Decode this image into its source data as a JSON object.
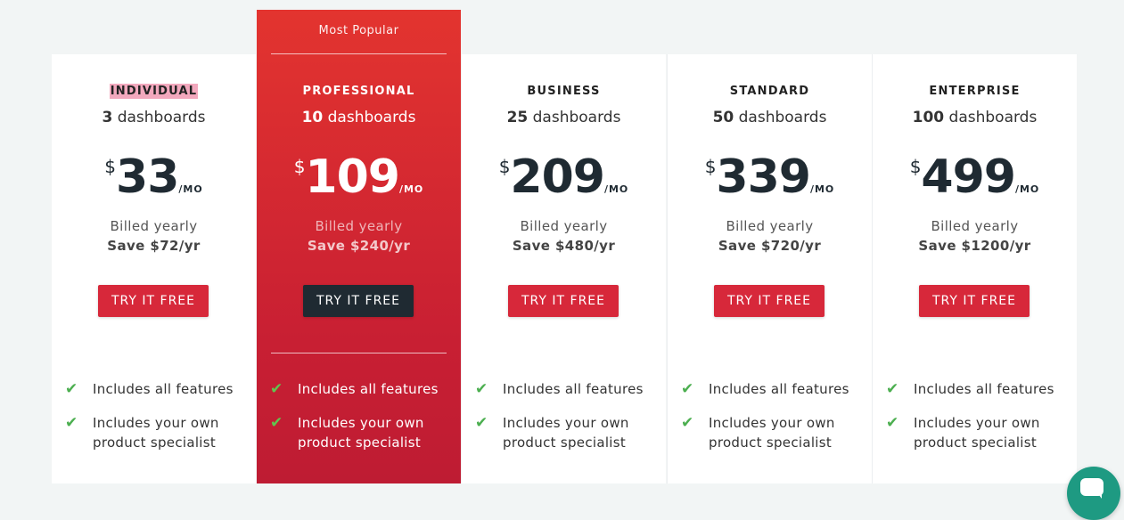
{
  "badge": "Most Popular",
  "plans": [
    {
      "tier": "INDIVIDUAL",
      "count": "3",
      "dash_label": "dashboards",
      "currency": "$",
      "price": "33",
      "period": "/MO",
      "billed": "Billed yearly",
      "save": "Save $72/yr",
      "cta": "TRY IT FREE"
    },
    {
      "tier": "PROFESSIONAL",
      "count": "10",
      "dash_label": "dashboards",
      "currency": "$",
      "price": "109",
      "period": "/MO",
      "billed": "Billed yearly",
      "save": "Save $240/yr",
      "cta": "TRY IT FREE"
    },
    {
      "tier": "BUSINESS",
      "count": "25",
      "dash_label": "dashboards",
      "currency": "$",
      "price": "209",
      "period": "/MO",
      "billed": "Billed yearly",
      "save": "Save $480/yr",
      "cta": "TRY IT FREE"
    },
    {
      "tier": "STANDARD",
      "count": "50",
      "dash_label": "dashboards",
      "currency": "$",
      "price": "339",
      "period": "/MO",
      "billed": "Billed yearly",
      "save": "Save $720/yr",
      "cta": "TRY IT FREE"
    },
    {
      "tier": "ENTERPRISE",
      "count": "100",
      "dash_label": "dashboards",
      "currency": "$",
      "price": "499",
      "period": "/MO",
      "billed": "Billed yearly",
      "save": "Save $1200/yr",
      "cta": "TRY IT FREE"
    }
  ],
  "features": [
    "Includes all features",
    "Includes your own product specialist"
  ],
  "check_icon": "check-icon",
  "chat_icon": "chat-icon",
  "colors": {
    "accent": "#d7283a",
    "featured_top": "#e3342f",
    "featured_bottom": "#be1c33",
    "dark_button": "#1f2a32",
    "check": "#4caf50",
    "chat": "#1e9a82",
    "highlight": "#f2a8bd"
  }
}
